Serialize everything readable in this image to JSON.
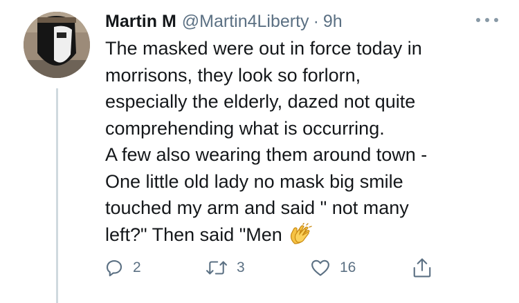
{
  "tweet": {
    "display_name": "Martin M",
    "handle": "@Martin4Liberty",
    "separator": "·",
    "time": "9h",
    "text_lines": [
      "The masked were out in force today in",
      "morrisons, they look so forlorn,",
      "especially the elderly, dazed not quite",
      "comprehending what is occurring.",
      "A few also wearing them around town -",
      "One little old lady no mask big smile",
      "touched my arm and said \" not many",
      "left?\" Then said \"Men"
    ],
    "emoji": "clapping-hands"
  },
  "actions": {
    "replies": "2",
    "retweets": "3",
    "likes": "16"
  },
  "icons": {
    "reply": "reply-icon",
    "retweet": "retweet-icon",
    "like": "heart-icon",
    "share": "share-icon",
    "more": "more-options-icon"
  },
  "colors": {
    "text": "#14171a",
    "secondary": "#5b7083",
    "thread_line": "#cfd9de"
  }
}
